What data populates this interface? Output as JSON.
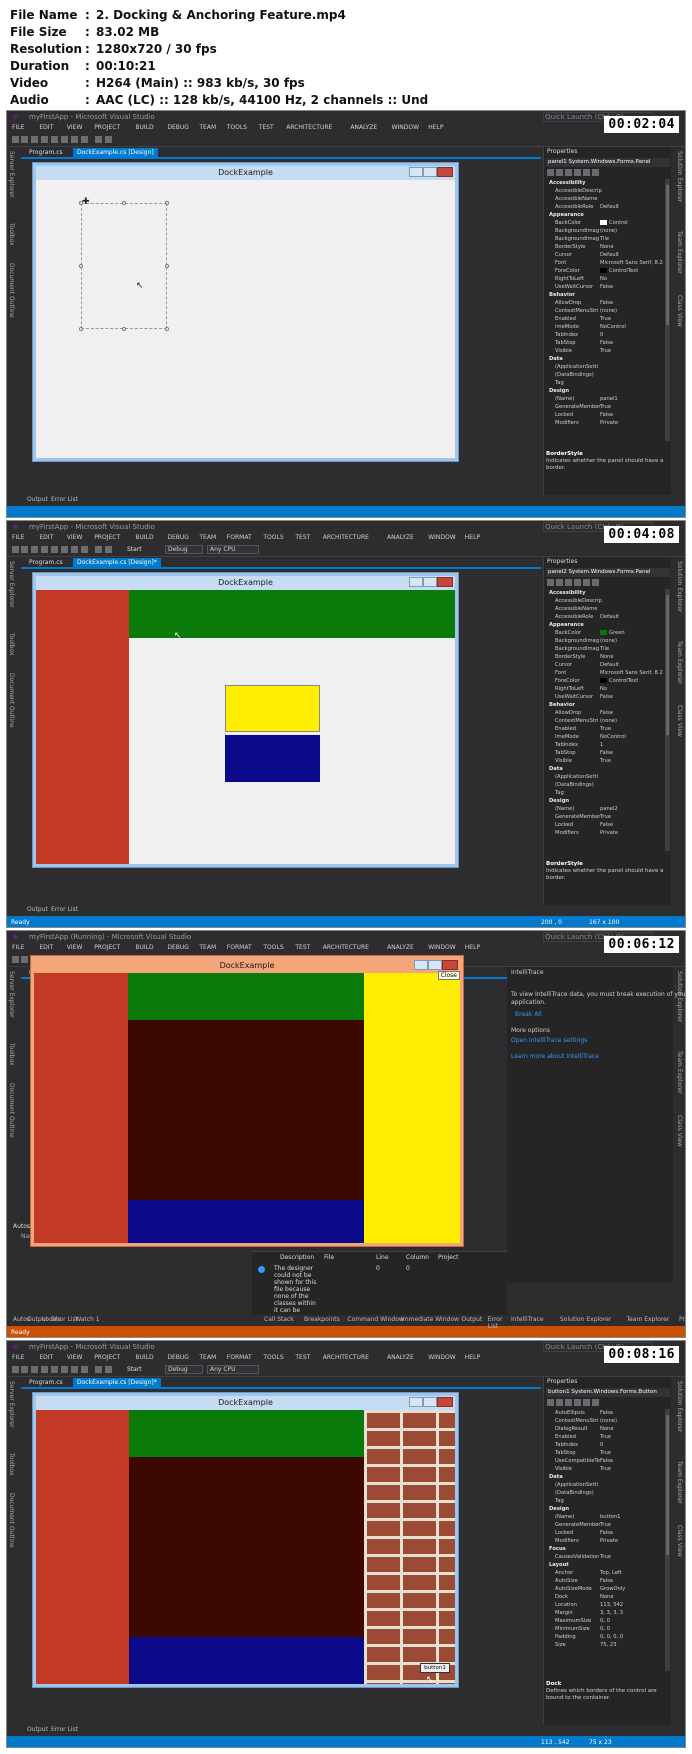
{
  "info": {
    "rows": [
      {
        "key": "File Name",
        "value": "2. Docking & Anchoring Feature.mp4"
      },
      {
        "key": "File Size",
        "value": "83.02 MB"
      },
      {
        "key": "Resolution",
        "value": "1280x720 / 30 fps"
      },
      {
        "key": "Duration",
        "value": "00:10:21"
      },
      {
        "key": "Video",
        "value": "H264 (Main) :: 983 kb/s, 30 fps"
      },
      {
        "key": "Audio",
        "value": "AAC (LC) :: 128 kb/s, 44100 Hz, 2 channels :: Und"
      }
    ],
    "separator": ":"
  },
  "vs": {
    "title": "myFirstApp - Microsoft Visual Studio",
    "title_running": "myFirstApp (Running) - Microsoft Visual Studio",
    "quick_launch": "Quick Launch (Ctrl+Q)",
    "menu_full": [
      "FILE",
      "EDIT",
      "VIEW",
      "PROJECT",
      "BUILD",
      "DEBUG",
      "TEAM",
      "FORMAT",
      "TOOLS",
      "TEST",
      "ARCHITECTURE",
      "ANALYZE",
      "WINDOW",
      "HELP"
    ],
    "menu_short": [
      "FILE",
      "EDIT",
      "VIEW",
      "PROJECT",
      "BUILD",
      "DEBUG",
      "TEAM",
      "TOOLS",
      "TEST",
      "ARCHITECTURE",
      "ANALYZE",
      "WINDOW",
      "HELP"
    ],
    "toolbar": {
      "start": "Start",
      "config": "Debug",
      "platform": "Any CPU"
    },
    "tabs": {
      "program": "Program.cs",
      "design": "DockExample.cs [Design]",
      "design_dirty": "DockExample.cs [Design]*"
    },
    "left_side": [
      "Server Explorer",
      "Toolbox",
      "Document Outline"
    ],
    "right_side": [
      "Solution Explorer",
      "Team Explorer",
      "Class View"
    ],
    "bottom_tabs": [
      "Output",
      "Error List"
    ],
    "status_ready": "Ready",
    "form_title": "DockExample",
    "props_title": "Properties"
  },
  "frames": [
    {
      "timestamp": "00:02:04",
      "props_object": "panel1  System.Windows.Forms.Panel",
      "status_pos": "",
      "status_size": ""
    },
    {
      "timestamp": "00:04:08",
      "props_object": "panel2  System.Windows.Forms.Panel",
      "status_pos": "200 , 0",
      "status_size": "167 x 100"
    },
    {
      "timestamp": "00:06:12",
      "close_tooltip": "Close",
      "intellitrace": {
        "title": "IntelliTrace",
        "line1": "To view IntelliTrace data, you must break execution of your",
        "line2": "application.",
        "break_all": "Break All",
        "more": "More options",
        "settings": "Open IntelliTrace settings",
        "learn": "Learn more about IntelliTrace"
      },
      "errors": {
        "cols": [
          "Description",
          "File",
          "Line",
          "Column",
          "Project"
        ],
        "desc": [
          "The designer",
          "could not be",
          "shown for this",
          "file because",
          "none of the",
          "classes within",
          "it can be"
        ],
        "line": "0",
        "column": "0"
      },
      "bottom_tabs_left": [
        "Autos",
        "Locals",
        "Watch 1"
      ],
      "bottom_tabs_mid": [
        "Call Stack",
        "Breakpoints",
        "Command Window",
        "Immediate Window",
        "Output",
        "Error List"
      ],
      "bottom_tabs_right": [
        "IntelliTrace",
        "Solution Explorer",
        "Team Explorer",
        "Properties"
      ],
      "autos": "Autos",
      "name_label": "Name",
      "status": "Ready"
    },
    {
      "timestamp": "00:08:16",
      "props_object": "button1  System.Windows.Forms.Button",
      "button_label": "button1",
      "status_pos": "113 , 542",
      "status_size": "75 x 23",
      "dock_desc_title": "Dock",
      "dock_desc": "Defines which borders of the control are bound to the container."
    }
  ],
  "props1": [
    {
      "cat": true,
      "n": "Accessibility"
    },
    {
      "n": "AccessibleDescrip",
      "v": ""
    },
    {
      "n": "AccessibleName",
      "v": ""
    },
    {
      "n": "AccessibleRole",
      "v": "Default"
    },
    {
      "cat": true,
      "n": "Appearance"
    },
    {
      "n": "BackColor",
      "v": "Control",
      "sw": "#ffffff"
    },
    {
      "n": "BackgroundImag",
      "v": "(none)"
    },
    {
      "n": "BackgroundImag",
      "v": "Tile"
    },
    {
      "n": "BorderStyle",
      "v": "None"
    },
    {
      "n": "Cursor",
      "v": "Default"
    },
    {
      "n": "Font",
      "v": "Microsoft Sans Serif, 8.2"
    },
    {
      "n": "ForeColor",
      "v": "ControlText",
      "sw": "#000000"
    },
    {
      "n": "RightToLeft",
      "v": "No"
    },
    {
      "n": "UseWaitCursor",
      "v": "False"
    },
    {
      "cat": true,
      "n": "Behavior"
    },
    {
      "n": "AllowDrop",
      "v": "False"
    },
    {
      "n": "ContextMenuStri",
      "v": "(none)"
    },
    {
      "n": "Enabled",
      "v": "True"
    },
    {
      "n": "ImeMode",
      "v": "NoControl"
    },
    {
      "n": "TabIndex",
      "v": "0"
    },
    {
      "n": "TabStop",
      "v": "False"
    },
    {
      "n": "Visible",
      "v": "True"
    },
    {
      "cat": true,
      "n": "Data"
    },
    {
      "n": "(ApplicationSetti",
      "v": ""
    },
    {
      "n": "(DataBindings)",
      "v": ""
    },
    {
      "n": "Tag",
      "v": ""
    },
    {
      "cat": true,
      "n": "Design"
    },
    {
      "n": "(Name)",
      "v": "panel1"
    },
    {
      "n": "GenerateMember",
      "v": "True"
    },
    {
      "n": "Locked",
      "v": "False"
    },
    {
      "n": "Modifiers",
      "v": "Private"
    }
  ],
  "props2": [
    {
      "cat": true,
      "n": "Accessibility"
    },
    {
      "n": "AccessibleDescrip",
      "v": ""
    },
    {
      "n": "AccessibleName",
      "v": ""
    },
    {
      "n": "AccessibleRole",
      "v": "Default"
    },
    {
      "cat": true,
      "n": "Appearance"
    },
    {
      "n": "BackColor",
      "v": "Green",
      "sw": "#007a00"
    },
    {
      "n": "BackgroundImag",
      "v": "(none)"
    },
    {
      "n": "BackgroundImag",
      "v": "Tile"
    },
    {
      "n": "BorderStyle",
      "v": "None"
    },
    {
      "n": "Cursor",
      "v": "Default"
    },
    {
      "n": "Font",
      "v": "Microsoft Sans Serif, 8.2"
    },
    {
      "n": "ForeColor",
      "v": "ControlText",
      "sw": "#000000"
    },
    {
      "n": "RightToLeft",
      "v": "No"
    },
    {
      "n": "UseWaitCursor",
      "v": "False"
    },
    {
      "cat": true,
      "n": "Behavior"
    },
    {
      "n": "AllowDrop",
      "v": "False"
    },
    {
      "n": "ContextMenuStri",
      "v": "(none)"
    },
    {
      "n": "Enabled",
      "v": "True"
    },
    {
      "n": "ImeMode",
      "v": "NoControl"
    },
    {
      "n": "TabIndex",
      "v": "1"
    },
    {
      "n": "TabStop",
      "v": "False"
    },
    {
      "n": "Visible",
      "v": "True"
    },
    {
      "cat": true,
      "n": "Data"
    },
    {
      "n": "(ApplicationSetti",
      "v": ""
    },
    {
      "n": "(DataBindings)",
      "v": ""
    },
    {
      "n": "Tag",
      "v": ""
    },
    {
      "cat": true,
      "n": "Design"
    },
    {
      "n": "(Name)",
      "v": "panel2"
    },
    {
      "n": "GenerateMember",
      "v": "True"
    },
    {
      "n": "Locked",
      "v": "False"
    },
    {
      "n": "Modifiers",
      "v": "Private"
    }
  ],
  "props4": [
    {
      "n": "AutoEllipsis",
      "v": "False"
    },
    {
      "n": "ContextMenuStri",
      "v": "(none)"
    },
    {
      "n": "DialogResult",
      "v": "None"
    },
    {
      "n": "Enabled",
      "v": "True"
    },
    {
      "n": "TabIndex",
      "v": "0"
    },
    {
      "n": "TabStop",
      "v": "True"
    },
    {
      "n": "UseCompatibleTe",
      "v": "False"
    },
    {
      "n": "Visible",
      "v": "True"
    },
    {
      "cat": true,
      "n": "Data"
    },
    {
      "n": "(ApplicationSetti",
      "v": ""
    },
    {
      "n": "(DataBindings)",
      "v": ""
    },
    {
      "n": "Tag",
      "v": ""
    },
    {
      "cat": true,
      "n": "Design"
    },
    {
      "n": "(Name)",
      "v": "button1"
    },
    {
      "n": "GenerateMember",
      "v": "True"
    },
    {
      "n": "Locked",
      "v": "False"
    },
    {
      "n": "Modifiers",
      "v": "Private"
    },
    {
      "cat": true,
      "n": "Focus"
    },
    {
      "n": "CausesValidation",
      "v": "True"
    },
    {
      "cat": true,
      "n": "Layout"
    },
    {
      "n": "Anchor",
      "v": "Top, Left"
    },
    {
      "n": "AutoSize",
      "v": "False"
    },
    {
      "n": "AutoSizeMode",
      "v": "GrowOnly"
    },
    {
      "n": "Dock",
      "v": "None"
    },
    {
      "n": "Location",
      "v": "113, 542"
    },
    {
      "n": "Margin",
      "v": "3, 3, 3, 3"
    },
    {
      "n": "MaximumSize",
      "v": "0, 0"
    },
    {
      "n": "MinimumSize",
      "v": "0, 0"
    },
    {
      "n": "Padding",
      "v": "0, 0, 0, 0"
    },
    {
      "n": "Size",
      "v": "75, 23"
    }
  ],
  "props_desc1": {
    "title": "BorderStyle",
    "text": "Indicates whether the panel should have a border."
  },
  "props_desc2": {
    "title": "BorderStyle",
    "text": "Indicates whether the panel should have a border."
  },
  "colors": {
    "vs_bg": "#2d2d30",
    "accent": "#007acc",
    "red_panel": "#c23a26",
    "green_panel": "#0a7a0a",
    "yellow_panel": "#ffee00",
    "navy_panel": "#0a0a8a",
    "maroon_panel": "#3d0800",
    "orange_status": "#ca5100"
  }
}
